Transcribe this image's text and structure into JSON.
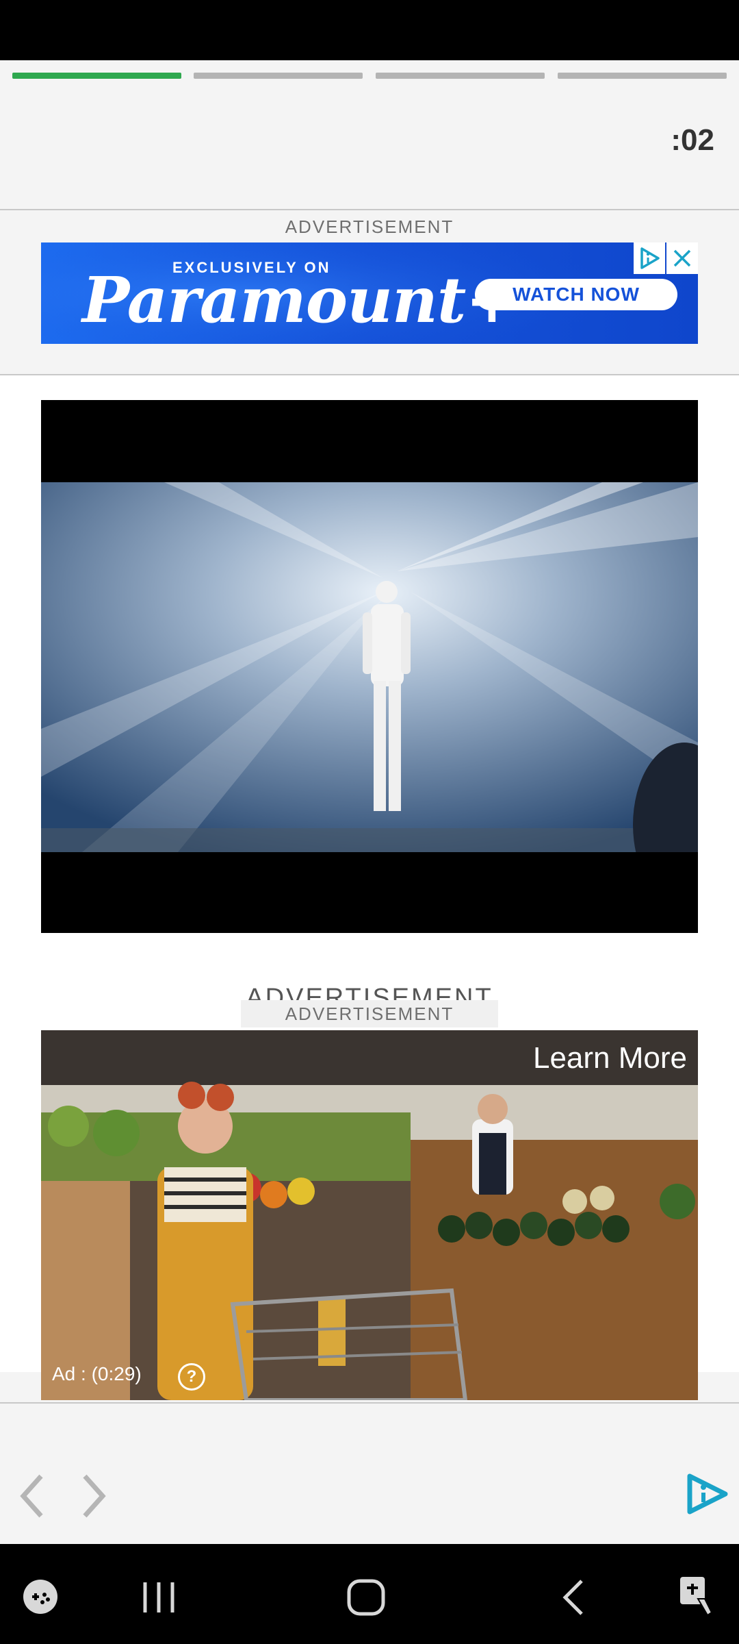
{
  "status_bar": {},
  "story_progress": {
    "segments": [
      {
        "state": "active",
        "color": "#2fa84f"
      },
      {
        "state": "inactive",
        "color": "#b4b4b4"
      },
      {
        "state": "inactive",
        "color": "#b4b4b4"
      },
      {
        "state": "inactive",
        "color": "#b4b4b4"
      }
    ],
    "timer": ":02"
  },
  "banner_ad": {
    "label": "ADVERTISEMENT",
    "tagline": "EXCLUSIVELY ON",
    "brand": "Paramount+",
    "cta": "WATCH NOW",
    "adchoices_icon": "adchoices-icon",
    "close_icon": "close-icon"
  },
  "video_player": {
    "description_icon": "video-frame"
  },
  "video_ad": {
    "ghost_label": "ADVERTISEMENT",
    "label": "ADVERTISEMENT",
    "learn_more": "Learn More",
    "ad_time": "Ad : (0:29)",
    "help_icon": "help-icon",
    "help_glyph": "?"
  },
  "bottom_toolbar": {
    "back_icon": "chevron-left-icon",
    "forward_icon": "chevron-right-icon",
    "brand_icon": "play-brand-icon",
    "accent": "#1aa3c8"
  },
  "system_nav": {
    "game_icon": "gamepad-icon",
    "recents_icon": "recents-icon",
    "home_icon": "home-icon",
    "back_icon": "back-icon",
    "accessibility_icon": "accessibility-icon"
  }
}
